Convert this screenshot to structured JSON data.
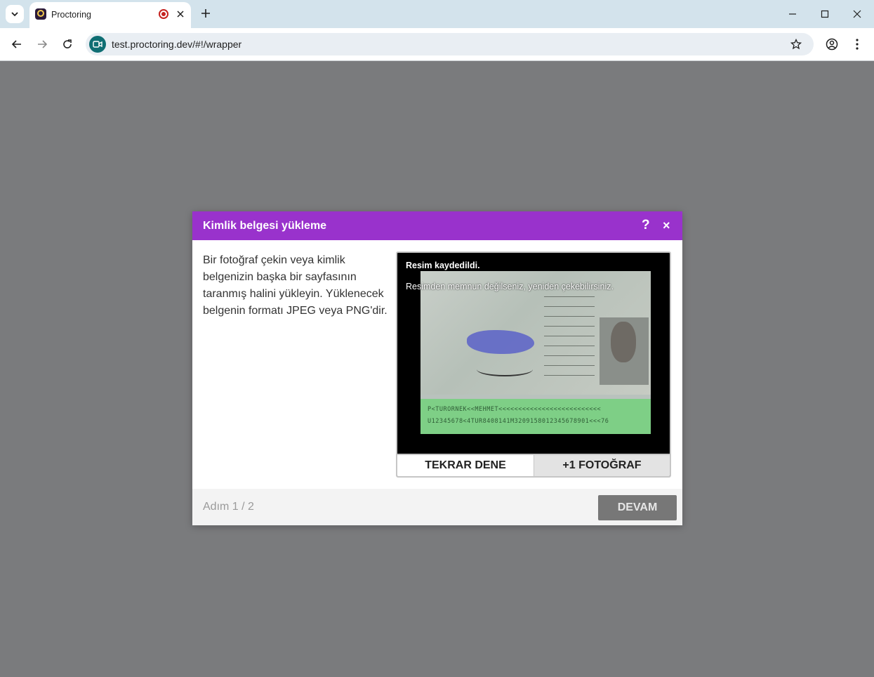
{
  "browser": {
    "tab_title": "Proctoring",
    "url": "test.proctoring.dev/#!/wrapper"
  },
  "modal": {
    "title": "Kimlik belgesi yükleme",
    "help_label": "?",
    "close_label": "×",
    "instructions": "Bir fotoğraf çekin veya kimlik belgenizin başka bir sayfasının taranmış halini yükleyin. Yüklenecek belgenin formatı JPEG veya PNG'dir.",
    "preview": {
      "saved_message": "Resim kaydedildi.",
      "retake_hint": "Resimden memnun değilseniz, yeniden çekebilirsiniz.",
      "mrz_line1": "P<TURORNEK<<MEHMET<<<<<<<<<<<<<<<<<<<<<<<<<<",
      "mrz_line2": "U12345678<4TUR8408141M3209158012345678901<<<76"
    },
    "buttons": {
      "retry": "TEKRAR DENE",
      "add_photo": "+1 FOTOĞRAF",
      "next": "DEVAM"
    },
    "step": "Adım 1 / 2"
  },
  "colors": {
    "header": "#9932cc",
    "overlay": "#7a7b7d"
  }
}
